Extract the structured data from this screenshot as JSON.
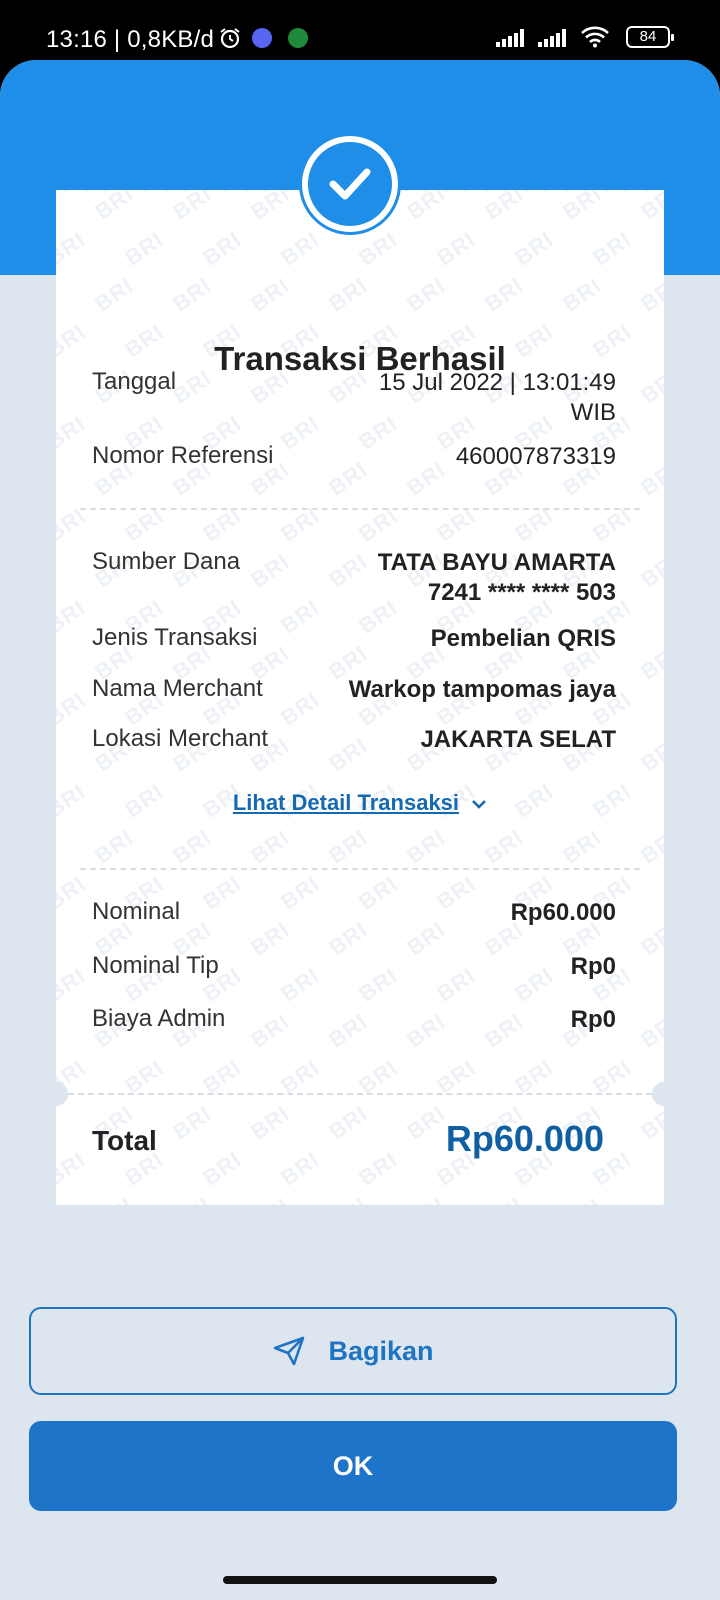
{
  "status_bar": {
    "time_info": "13:16 | 0,8KB/d",
    "battery": "84"
  },
  "receipt": {
    "title": "Transaksi Berhasil",
    "watermark_text": "BRI",
    "date_label": "Tanggal",
    "date_line1": "15 Jul 2022 | 13:01:49",
    "date_line2": "WIB",
    "ref_label": "Nomor Referensi",
    "ref_value": "460007873319",
    "source_label": "Sumber Dana",
    "source_name": "TATA BAYU AMARTA",
    "source_account": "7241 **** **** 503",
    "type_label": "Jenis Transaksi",
    "type_value": "Pembelian QRIS",
    "merchant_label": "Nama Merchant",
    "merchant_value": "Warkop tampomas jaya",
    "location_label": "Lokasi Merchant",
    "location_value": "JAKARTA SELAT",
    "detail_link": "Lihat Detail Transaksi",
    "nominal_label": "Nominal",
    "nominal_value": "Rp60.000",
    "tip_label": "Nominal Tip",
    "tip_value": "Rp0",
    "admin_label": "Biaya Admin",
    "admin_value": "Rp0",
    "total_label": "Total",
    "total_value": "Rp60.000"
  },
  "buttons": {
    "share": "Bagikan",
    "ok": "OK"
  },
  "colors": {
    "brand_blue": "#1e8ee8",
    "button_blue": "#1e74c8",
    "total_blue": "#0e5fa3",
    "background": "#dde6ee"
  }
}
